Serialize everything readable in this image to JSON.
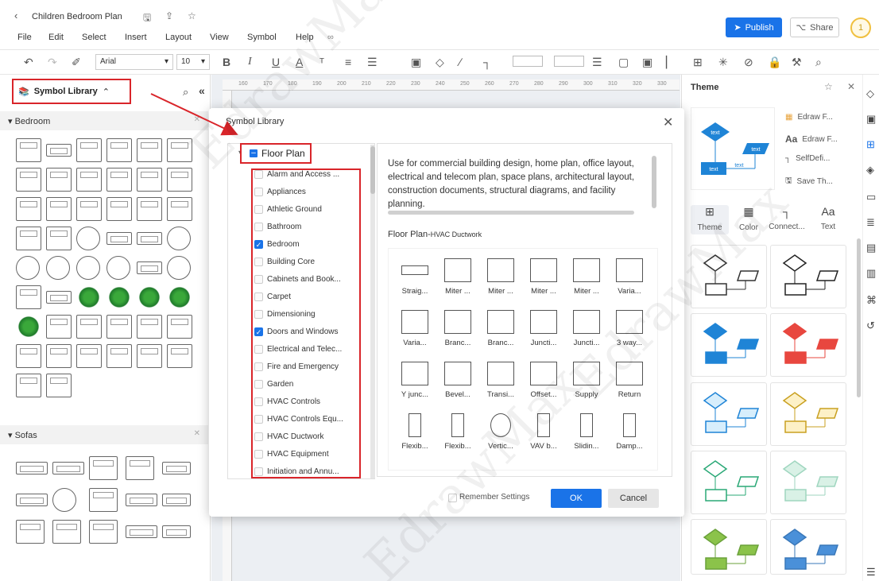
{
  "titlebar": {
    "back_icon": "chevron-left-icon",
    "doc_title": "Children Bedroom Plan",
    "publish_label": "Publish",
    "share_label": "Share",
    "user_badge": "1"
  },
  "menu": [
    "File",
    "Edit",
    "Select",
    "Insert",
    "Layout",
    "View",
    "Symbol",
    "Help"
  ],
  "toolbar": {
    "font": "Arial",
    "font_size": "10"
  },
  "left_panel": {
    "title": "Symbol Library",
    "sections": [
      {
        "name": "Bedroom"
      },
      {
        "name": "Sofas"
      }
    ]
  },
  "ruler": {
    "top": [
      "160",
      "170",
      "180",
      "190",
      "200",
      "210",
      "220",
      "230",
      "240",
      "250",
      "260",
      "270",
      "280",
      "290",
      "300",
      "310",
      "320",
      "330"
    ]
  },
  "theme_panel": {
    "title": "Theme",
    "options": [
      "Edraw F...",
      "Edraw F...",
      "SelfDefi...",
      "Save Th..."
    ],
    "tabs": [
      "Theme",
      "Color",
      "Connect...",
      "Text"
    ],
    "preview_texts": [
      "text",
      "text",
      "text",
      "text"
    ],
    "colors": {
      "blue": "#1f84d6",
      "red": "#e8473f",
      "teal_green": "#2aa876",
      "yellow": "#f3d06b",
      "lime": "#8bc34a",
      "sky": "#4a90d9"
    }
  },
  "dialog": {
    "title": "Symbol Library",
    "root": "Floor Plan",
    "categories": [
      {
        "label": "Alarm and Access ...",
        "checked": false
      },
      {
        "label": "Appliances",
        "checked": false
      },
      {
        "label": "Athletic Ground",
        "checked": false
      },
      {
        "label": "Bathroom",
        "checked": false
      },
      {
        "label": "Bedroom",
        "checked": true
      },
      {
        "label": "Building Core",
        "checked": false
      },
      {
        "label": "Cabinets and Book...",
        "checked": false
      },
      {
        "label": "Carpet",
        "checked": false
      },
      {
        "label": "Dimensioning",
        "checked": false
      },
      {
        "label": "Doors and Windows",
        "checked": true
      },
      {
        "label": "Electrical and Telec...",
        "checked": false
      },
      {
        "label": "Fire and Emergency",
        "checked": false
      },
      {
        "label": "Garden",
        "checked": false
      },
      {
        "label": "HVAC Controls",
        "checked": false
      },
      {
        "label": "HVAC Controls Equ...",
        "checked": false
      },
      {
        "label": "HVAC Ductwork",
        "checked": false
      },
      {
        "label": "HVAC Equipment",
        "checked": false
      },
      {
        "label": "Initiation and Annu...",
        "checked": false
      }
    ],
    "description": "Use for commercial building design, home plan, office layout, electrical and telecom plan, space plans, architectural layout, construction documents, structural diagrams, and facility planning.",
    "subtitle_main": "Floor Plan-",
    "subtitle_sub": "HVAC Ductwork",
    "shapes": [
      "Straig...",
      "Miter ...",
      "Miter ...",
      "Miter ...",
      "Miter ...",
      "Varia...",
      "Varia...",
      "Branc...",
      "Branc...",
      "Juncti...",
      "Juncti...",
      "3 way...",
      "Y junc...",
      "Bevel...",
      "Transi...",
      "Offset...",
      "Supply",
      "Return",
      "Flexib...",
      "Flexib...",
      "Vertic...",
      "VAV b...",
      "Slidin...",
      "Damp..."
    ],
    "remember_label": "Remember Settings",
    "ok_label": "OK",
    "cancel_label": "Cancel"
  },
  "watermark": "EdrawMax"
}
